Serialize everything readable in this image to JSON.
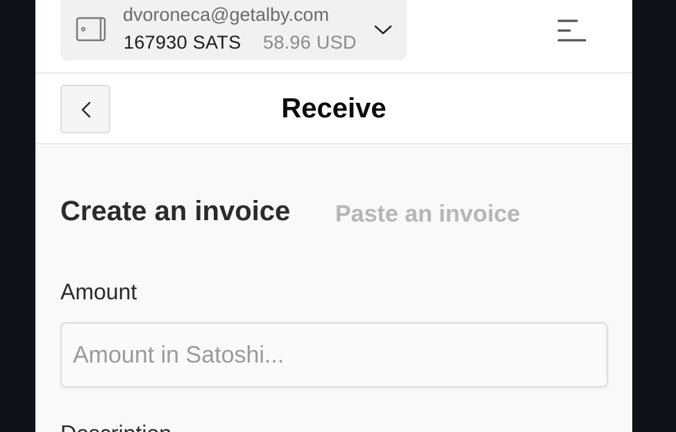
{
  "account": {
    "email": "dvoronecа@getalby.com",
    "balance_sats": "167930 SATS",
    "balance_fiat": "58.96 USD",
    "wallet_icon": "wallet-icon",
    "chevron_icon": "chevron-down-icon"
  },
  "menu": {
    "icon": "hamburger-menu-icon"
  },
  "header": {
    "title": "Receive",
    "back_icon": "chevron-left-icon"
  },
  "tabs": [
    {
      "label": "Create an invoice",
      "active": true
    },
    {
      "label": "Paste an invoice",
      "active": false
    }
  ],
  "form": {
    "amount_label": "Amount",
    "amount_placeholder": "Amount in Satoshi...",
    "amount_value": "",
    "description_label": "Description"
  },
  "colors": {
    "background": "#f9f9f9",
    "outer": "#0f1217",
    "text": "#2b2b2b",
    "muted": "#b6b6b6"
  }
}
